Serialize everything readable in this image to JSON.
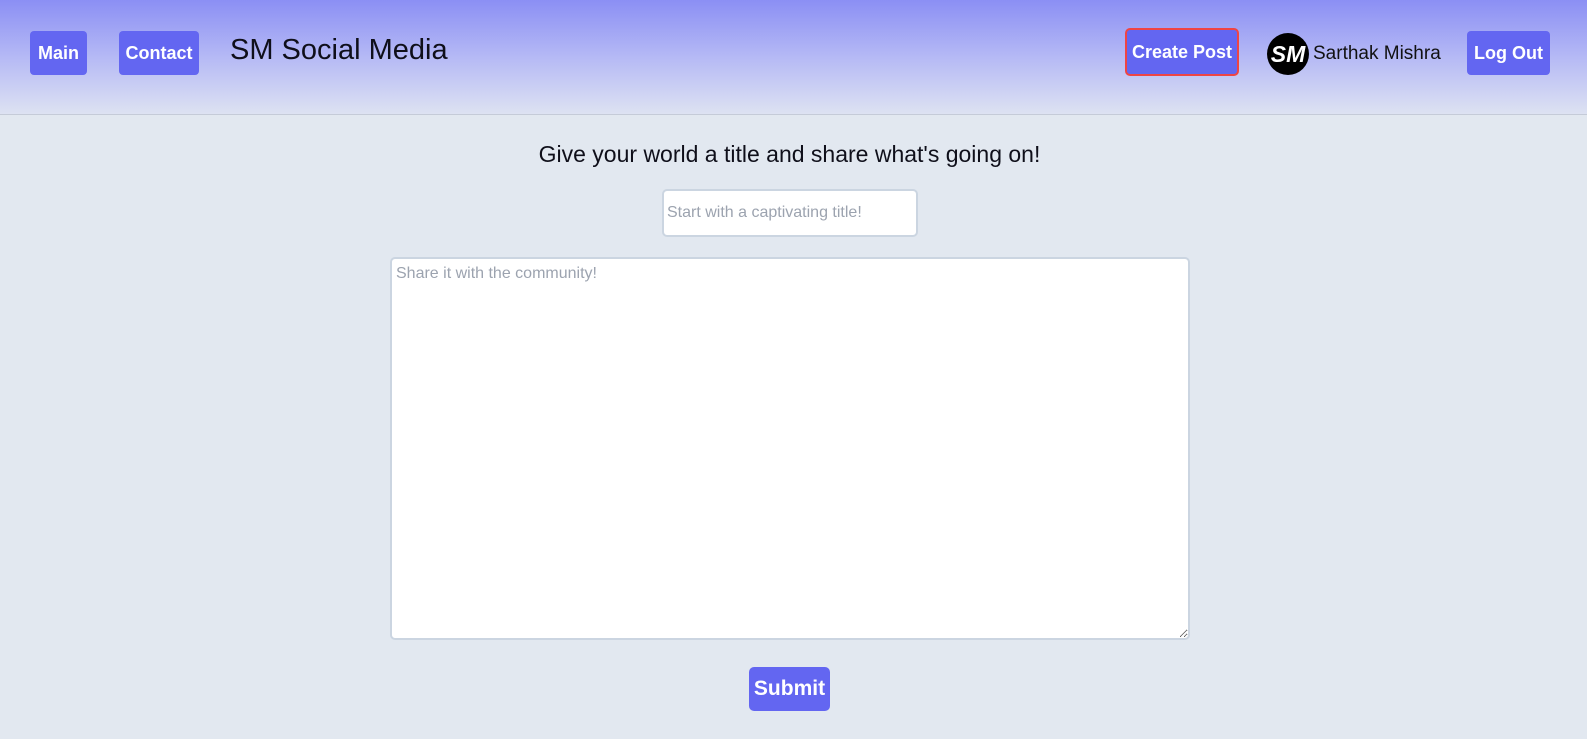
{
  "header": {
    "nav": {
      "main_label": "Main",
      "contact_label": "Contact"
    },
    "site_title": "SM Social Media",
    "create_post_label": "Create Post",
    "user": {
      "avatar_text": "SM",
      "name": "Sarthak Mishra"
    },
    "logout_label": "Log Out"
  },
  "form": {
    "heading": "Give your world a title and share what's going on!",
    "title_input": {
      "value": "",
      "placeholder": "Start with a captivating title!"
    },
    "body_input": {
      "value": "",
      "placeholder": "Share it with the community!"
    },
    "submit_label": "Submit"
  },
  "colors": {
    "accent": "#6366f1",
    "highlight_border": "#ef4444",
    "background": "#e2e8f0"
  }
}
